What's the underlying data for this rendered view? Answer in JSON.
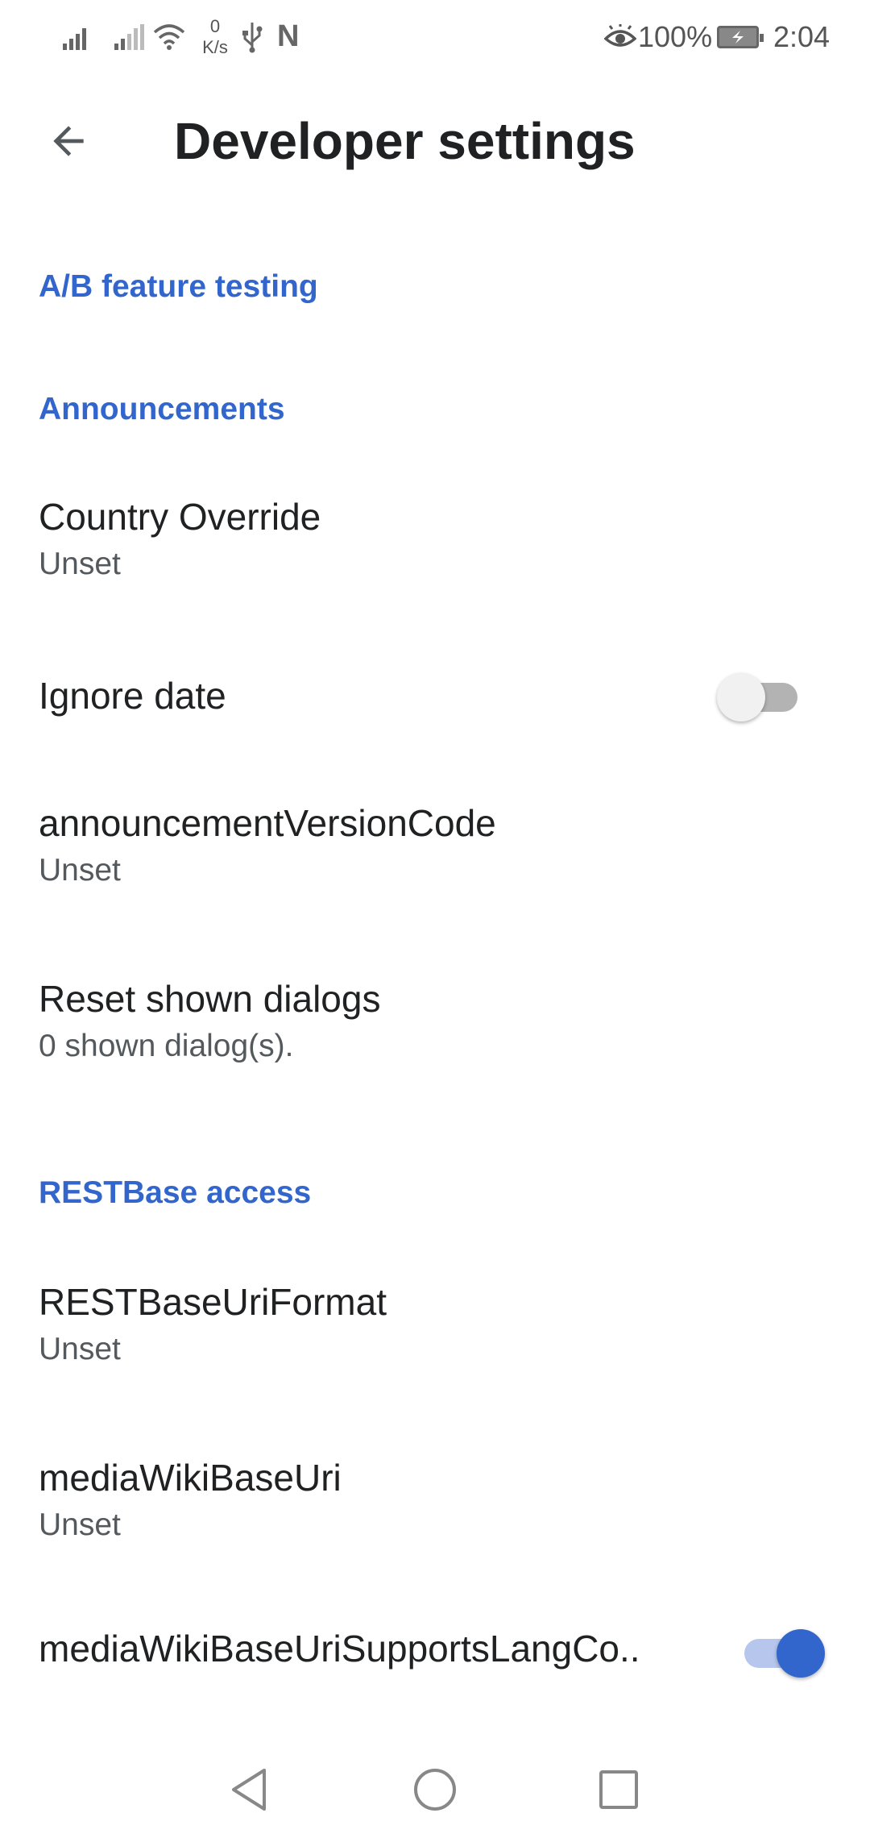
{
  "status_bar": {
    "net_speed_value": "0",
    "net_speed_unit": "K/s",
    "battery_percent": "100%",
    "time": "2:04"
  },
  "toolbar": {
    "title": "Developer settings",
    "back_icon": "arrow-back-icon"
  },
  "settings": {
    "section_ab": "A/B feature testing",
    "section_announcements": "Announcements",
    "country_override": {
      "title": "Country Override",
      "summary": "Unset"
    },
    "ignore_date": {
      "title": "Ignore date",
      "enabled": false
    },
    "announcement_version_code": {
      "title": "announcementVersionCode",
      "summary": "Unset"
    },
    "reset_shown_dialogs": {
      "title": "Reset shown dialogs",
      "summary": "0 shown dialog(s)."
    },
    "section_restbase": "RESTBase access",
    "restbase_uri_format": {
      "title": "RESTBaseUriFormat",
      "summary": "Unset"
    },
    "mediawiki_base_uri": {
      "title": "mediaWikiBaseUri",
      "summary": "Unset"
    },
    "mediawiki_supports_lang": {
      "title": "mediaWikiBaseUriSupportsLangCo..",
      "enabled": true
    }
  },
  "nav_bar": {
    "back_icon": "triangle-back-icon",
    "home_icon": "circle-home-icon",
    "recents_icon": "square-recents-icon"
  },
  "colors": {
    "accent": "#3366cc",
    "title_text": "#202122",
    "summary_text": "#54595d"
  }
}
